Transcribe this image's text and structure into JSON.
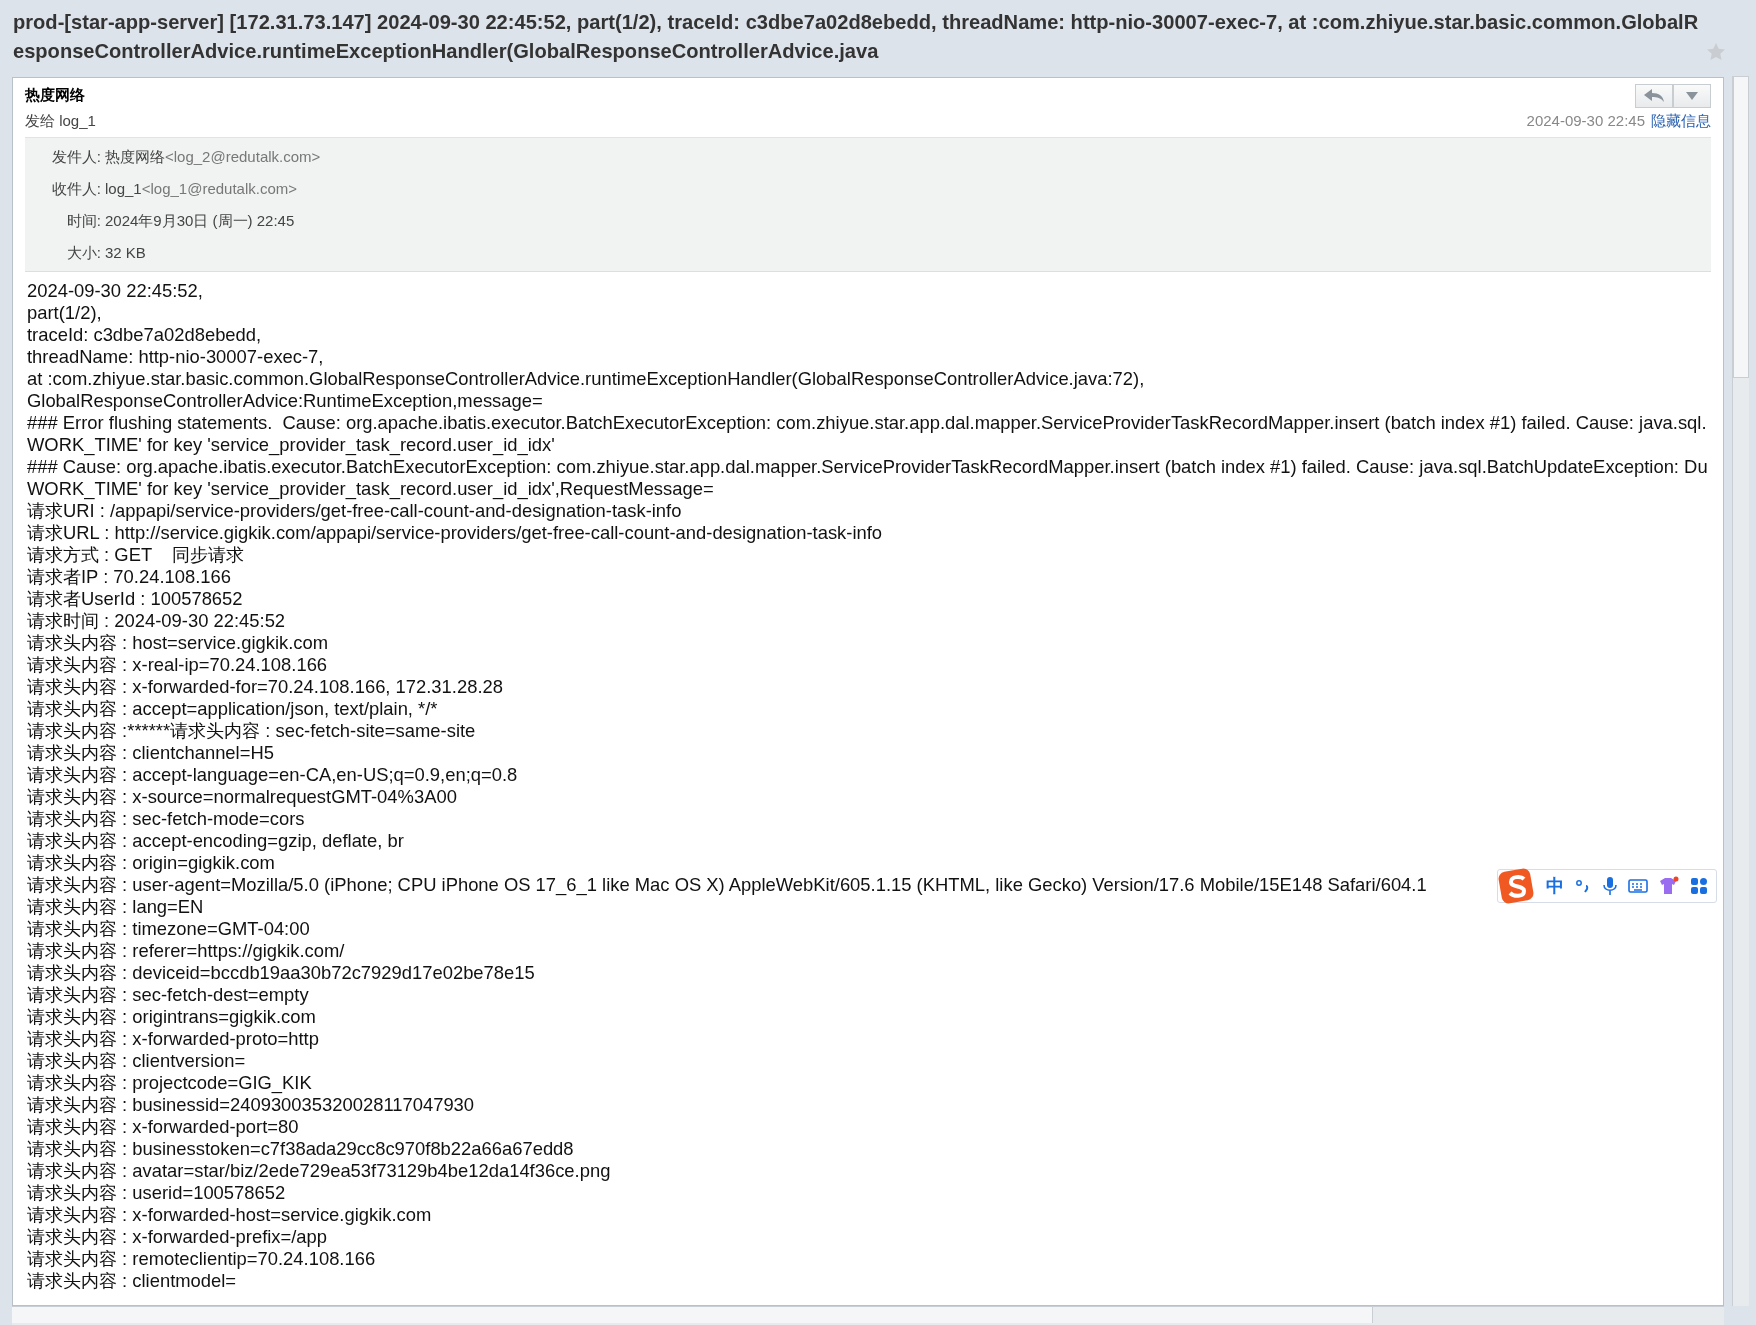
{
  "subject": "prod-[star-app-server] [172.31.73.147] 2024-09-30 22:45:52, part(1/2), traceId: c3dbe7a02d8ebedd, threadName: http-nio-30007-exec-7, at :com.zhiyue.star.basic.common.GlobalResponseControllerAdvice.runtimeExceptionHandler(GlobalResponseControllerAdvice.java",
  "starred": false,
  "message": {
    "sender": "热度网络",
    "to_line": "发给 log_1",
    "date": "2024-09-30 22:45",
    "hide_link": "隐藏信息",
    "details": [
      {
        "label": "发件人:",
        "value": "热度网络",
        "email": "<log_2@redutalk.com>"
      },
      {
        "label": "收件人:",
        "value": "log_1",
        "email": "<log_1@redutalk.com>"
      },
      {
        "label": "时间:",
        "value": "2024年9月30日 (周一) 22:45"
      },
      {
        "label": "大小:",
        "value": "32 KB"
      }
    ],
    "body_lines": [
      "2024-09-30 22:45:52,",
      "part(1/2),",
      "traceId: c3dbe7a02d8ebedd,",
      "threadName: http-nio-30007-exec-7,",
      "at :com.zhiyue.star.basic.common.GlobalResponseControllerAdvice.runtimeExceptionHandler(GlobalResponseControllerAdvice.java:72),",
      "GlobalResponseControllerAdvice:RuntimeException,message=",
      "### Error flushing statements.  Cause: org.apache.ibatis.executor.BatchExecutorException: com.zhiyue.star.app.dal.mapper.ServiceProviderTaskRecordMapper.insert (batch index #1) failed. Cause: java.sql.",
      "WORK_TIME' for key 'service_provider_task_record.user_id_idx'",
      "### Cause: org.apache.ibatis.executor.BatchExecutorException: com.zhiyue.star.app.dal.mapper.ServiceProviderTaskRecordMapper.insert (batch index #1) failed. Cause: java.sql.BatchUpdateException: Du",
      "WORK_TIME' for key 'service_provider_task_record.user_id_idx',RequestMessage=",
      "请求URI : /appapi/service-providers/get-free-call-count-and-designation-task-info",
      "请求URL : http://service.gigkik.com/appapi/service-providers/get-free-call-count-and-designation-task-info",
      "请求方式 : GET    同步请求",
      "请求者IP : 70.24.108.166",
      "请求者UserId : 100578652",
      "请求时间 : 2024-09-30 22:45:52",
      "请求头内容 : host=service.gigkik.com",
      "请求头内容 : x-real-ip=70.24.108.166",
      "请求头内容 : x-forwarded-for=70.24.108.166, 172.31.28.28",
      "请求头内容 : accept=application/json, text/plain, */*",
      "请求头内容 :******请求头内容 : sec-fetch-site=same-site",
      "请求头内容 : clientchannel=H5",
      "请求头内容 : accept-language=en-CA,en-US;q=0.9,en;q=0.8",
      "请求头内容 : x-source=normalrequestGMT-04%3A00",
      "请求头内容 : sec-fetch-mode=cors",
      "请求头内容 : accept-encoding=gzip, deflate, br",
      "请求头内容 : origin=gigkik.com",
      "请求头内容 : user-agent=Mozilla/5.0 (iPhone; CPU iPhone OS 17_6_1 like Mac OS X) AppleWebKit/605.1.15 (KHTML, like Gecko) Version/17.6 Mobile/15E148 Safari/604.1",
      "请求头内容 : lang=EN",
      "请求头内容 : timezone=GMT-04:00",
      "请求头内容 : referer=https://gigkik.com/",
      "请求头内容 : deviceid=bccdb19aa30b72c7929d17e02be78e15",
      "请求头内容 : sec-fetch-dest=empty",
      "请求头内容 : origintrans=gigkik.com",
      "请求头内容 : x-forwarded-proto=http",
      "请求头内容 : clientversion=",
      "请求头内容 : projectcode=GIG_KIK",
      "请求头内容 : businessid=240930035320028117047930",
      "请求头内容 : x-forwarded-port=80",
      "请求头内容 : businesstoken=c7f38ada29cc8c970f8b22a66a67edd8",
      "请求头内容 : avatar=star/biz/2ede729ea53f73129b4be12da14f36ce.png",
      "请求头内容 : userid=100578652",
      "请求头内容 : x-forwarded-host=service.gigkik.com",
      "请求头内容 : x-forwarded-prefix=/app",
      "请求头内容 : remoteclientip=70.24.108.166",
      "请求头内容 : clientmodel="
    ]
  },
  "ime_toolbar": {
    "mode": "中"
  }
}
